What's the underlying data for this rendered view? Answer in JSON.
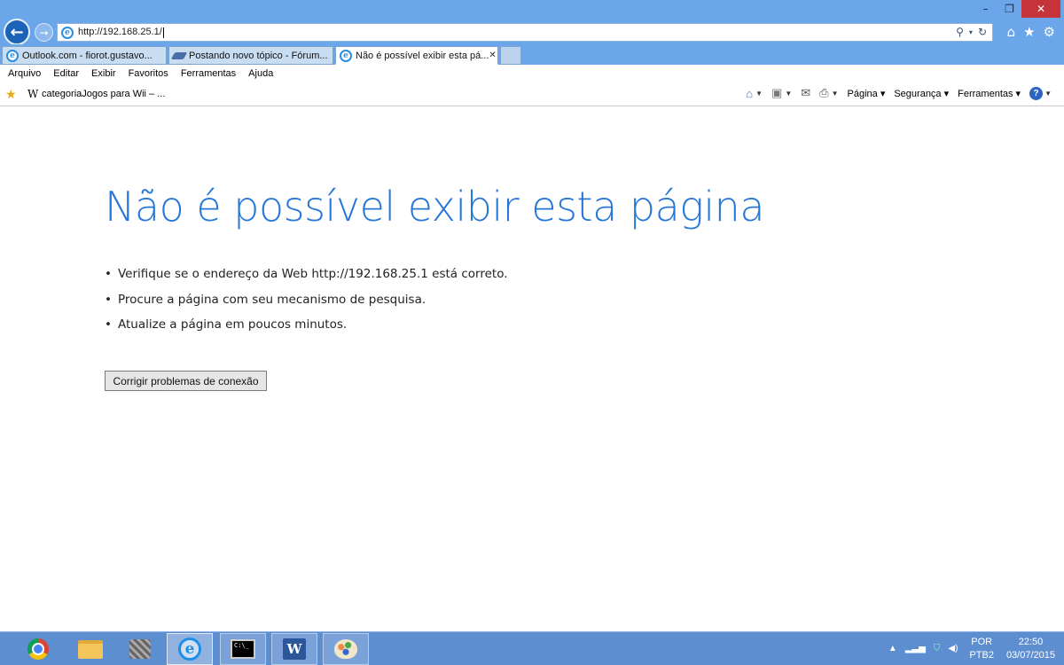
{
  "browser": {
    "address_url": "http://192.168.25.1/",
    "window_controls": {
      "minimize": "–",
      "restore": "❐",
      "close": "✕"
    },
    "tabs": [
      {
        "label": "Outlook.com - fiorot.gustavo...",
        "icon": "ie-icon",
        "active": false
      },
      {
        "label": "Postando novo tópico - Fórum...",
        "icon": "feather-icon",
        "active": false
      },
      {
        "label": "Não é possível exibir esta pá...",
        "icon": "ie-icon",
        "active": true
      }
    ],
    "menu": [
      "Arquivo",
      "Editar",
      "Exibir",
      "Favoritos",
      "Ferramentas",
      "Ajuda"
    ],
    "favorites": {
      "w_glyph": "W",
      "link": "categoriaJogos para Wii – ..."
    },
    "command_bar": {
      "pagina": "Página",
      "seguranca": "Segurança",
      "ferramentas": "Ferramentas"
    }
  },
  "page": {
    "title": "Não é possível exibir esta página",
    "bullets": [
      "Verifique se o endereço da Web http://192.168.25.1 está correto.",
      "Procure a página com seu mecanismo de pesquisa.",
      "Atualize a página em poucos minutos."
    ],
    "fix_button": "Corrigir problemas de conexão",
    "title_color": "#2677d8"
  },
  "taskbar": {
    "apps": [
      "chrome-icon",
      "file-explorer-icon",
      "system-icon",
      "internet-explorer-icon",
      "command-prompt-icon",
      "word-icon",
      "paint-icon"
    ],
    "language": {
      "top": "POR",
      "bottom": "PTB2"
    },
    "clock": {
      "time": "22:50",
      "date": "03/07/2015"
    }
  },
  "colors": {
    "titlebar": "#6aa6e9",
    "taskbar": "#5d8ed0",
    "close_button": "#c7333a"
  }
}
